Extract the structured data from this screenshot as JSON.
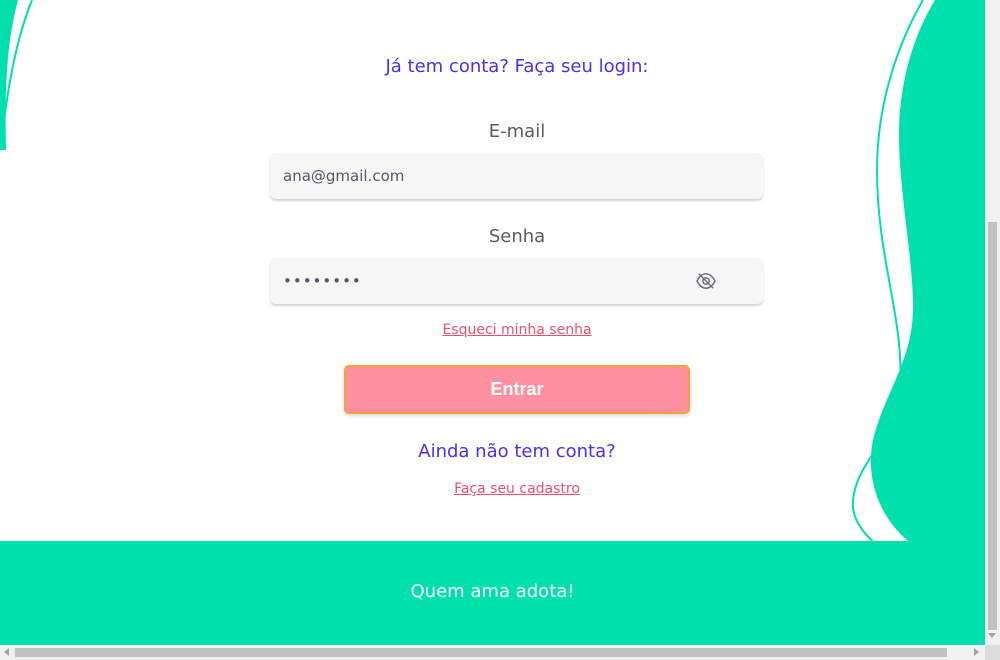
{
  "login": {
    "heading": "Já tem conta? Faça seu login:",
    "email_label": "E-mail",
    "email_value": "ana@gmail.com",
    "password_label": "Senha",
    "password_value": "••••••••",
    "forgot_link": "Esqueci minha senha",
    "submit_label": "Entrar"
  },
  "signup": {
    "heading": "Ainda não tem conta?",
    "link": "Faça seu cadastro"
  },
  "footer": {
    "tagline": "Quem ama adota!"
  },
  "icons": {
    "password_toggle": "eye-slash-icon"
  },
  "colors": {
    "accent_green": "#00e0af",
    "heading_purple": "#4a2ff0",
    "link_pink": "#ef4f6c",
    "button_pink": "#ff909f",
    "button_border": "#f2a43a"
  }
}
